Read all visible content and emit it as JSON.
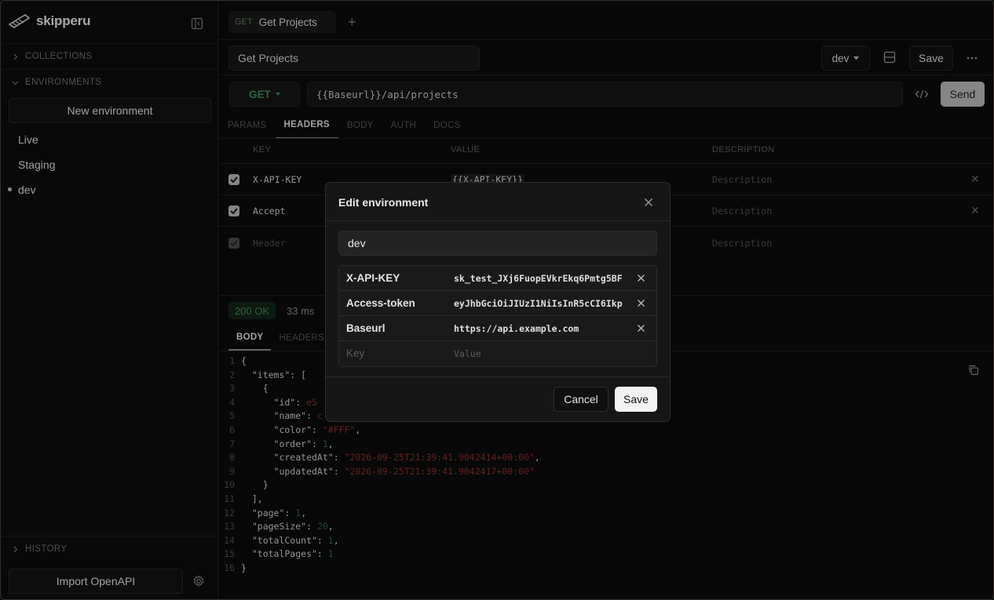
{
  "app": {
    "name": "skipperu"
  },
  "sidebar": {
    "collections_label": "COLLECTIONS",
    "environments_label": "ENVIRONMENTS",
    "new_environment_label": "New environment",
    "environments": [
      "Live",
      "Staging",
      "dev"
    ],
    "active_environment": "dev",
    "history_label": "HISTORY",
    "import_label": "Import OpenAPI"
  },
  "tabs": [
    {
      "method": "GET",
      "label": "Get Projects"
    }
  ],
  "request": {
    "name": "Get Projects",
    "environment": "dev",
    "save_label": "Save",
    "method": "GET",
    "url": "{{Baseurl}}/api/projects",
    "send_label": "Send",
    "subtabs": [
      "PARAMS",
      "HEADERS",
      "BODY",
      "AUTH",
      "DOCS"
    ],
    "active_subtab": "HEADERS"
  },
  "headers_table": {
    "columns": [
      "KEY",
      "VALUE",
      "DESCRIPTION"
    ],
    "rows": [
      {
        "enabled": true,
        "key": "X-API-KEY",
        "value": "{{X-API-KEY}}",
        "description": "Description"
      },
      {
        "enabled": true,
        "key": "Accept",
        "value": "",
        "description": "Description"
      },
      {
        "enabled": false,
        "key": "Header",
        "value": "",
        "description": "Description",
        "placeholder": true
      }
    ]
  },
  "response": {
    "status": "200 OK",
    "time": "33 ms",
    "tabs": [
      "BODY",
      "HEADERS"
    ],
    "active_tab": "BODY",
    "line_numbers": [
      "1",
      "2",
      "3",
      "4",
      "5",
      "6",
      "7",
      "8",
      "9",
      "10",
      "11",
      "12",
      "13",
      "14",
      "15",
      "16"
    ],
    "json_text": {
      "id": "e5",
      "name": "c",
      "color": "\"#FFF\"",
      "order": "1",
      "createdAt": "\"2026-09-25T21:39:41.9042414+00:00\"",
      "updatedAt": "\"2026-09-25T21:39:41.9042417+00:00\"",
      "page": "1",
      "pageSize": "20",
      "totalCount": "1",
      "totalPages": "1"
    }
  },
  "modal": {
    "title": "Edit environment",
    "name": "dev",
    "variables": [
      {
        "key": "X-API-KEY",
        "value": "sk_test_JXj6FuopEVkrEkq6Pmtg5BF"
      },
      {
        "key": "Access-token",
        "value": "eyJhbGciOiJIUzI1NiIsInR5cCI6Ikp"
      },
      {
        "key": "Baseurl",
        "value": "https://api.example.com"
      }
    ],
    "key_placeholder": "Key",
    "value_placeholder": "Value",
    "cancel_label": "Cancel",
    "save_label": "Save"
  },
  "colors": {
    "status_ok": "#3a8a52",
    "method_get": "#3f8a52",
    "string": "#8a2d2d",
    "number": "#2e6a4b"
  }
}
